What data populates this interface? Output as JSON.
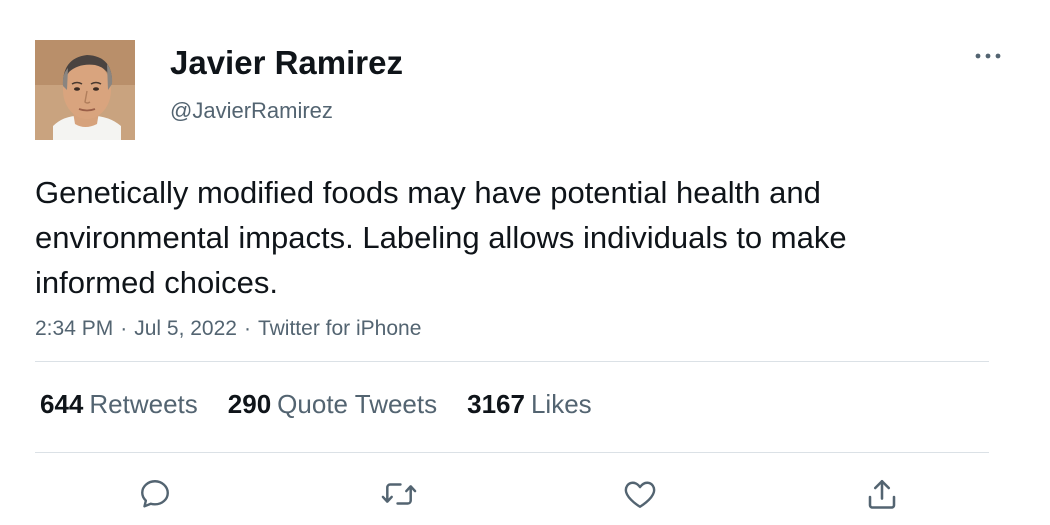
{
  "author": {
    "display_name": "Javier Ramirez",
    "handle": "@JavierRamirez"
  },
  "tweet": {
    "text": "Genetically modified foods may have potential health and environmental impacts. Labeling allows individuals to make informed choices."
  },
  "meta": {
    "time": "2:34 PM",
    "separator": "·",
    "date": "Jul 5, 2022",
    "source": "Twitter for iPhone"
  },
  "stats": {
    "retweets": {
      "count": "644",
      "label": "Retweets"
    },
    "quote_tweets": {
      "count": "290",
      "label": "Quote Tweets"
    },
    "likes": {
      "count": "3167",
      "label": "Likes"
    }
  },
  "icons": {
    "more": "more-horizontal-icon",
    "reply": "reply-icon",
    "retweet": "retweet-icon",
    "like": "heart-icon",
    "share": "share-icon"
  },
  "colors": {
    "text": "#0f1419",
    "secondary": "#536471",
    "divider": "#dbe1e6"
  }
}
